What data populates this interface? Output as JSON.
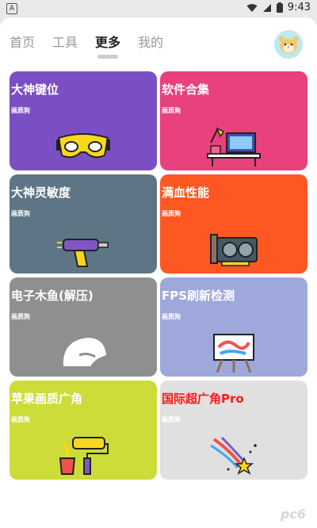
{
  "status_bar": {
    "app_badge": "A",
    "time": "9:43"
  },
  "tabs": [
    {
      "label": "首页",
      "active": false
    },
    {
      "label": "工具",
      "active": false
    },
    {
      "label": "更多",
      "active": true
    },
    {
      "label": "我的",
      "active": false
    }
  ],
  "cards": [
    {
      "title": "大神键位",
      "subtitle": "画质狗",
      "bg": "#7b4fc4",
      "title_color": "#ffffff",
      "icon": "vr-goggles-icon"
    },
    {
      "title": "软件合集",
      "subtitle": "画质狗",
      "bg": "#e8417d",
      "title_color": "#ffffff",
      "icon": "desk-computer-icon"
    },
    {
      "title": "大神灵敏度",
      "subtitle": "画质狗",
      "bg": "#5d7585",
      "title_color": "#ffffff",
      "icon": "power-drill-icon"
    },
    {
      "title": "满血性能",
      "subtitle": "画质狗",
      "bg": "#fe5722",
      "title_color": "#ffffff",
      "icon": "graphics-card-icon"
    },
    {
      "title": "电子木鱼(解压)",
      "subtitle": "画质狗",
      "bg": "#8f8f8f",
      "title_color": "#ffffff",
      "icon": "wooden-fish-icon"
    },
    {
      "title": "FPS刷新检测",
      "subtitle": "画质狗",
      "bg": "#9fa8da",
      "title_color": "#ffffff",
      "icon": "easel-painting-icon"
    },
    {
      "title": "苹果画质广角",
      "subtitle": "画质狗",
      "bg": "#cddc39",
      "title_color": "#ffffff",
      "icon": "paint-roller-icon"
    },
    {
      "title": "国际超广角Pro",
      "subtitle": "画质狗",
      "bg": "#e0e0e0",
      "title_color": "#ff1a1a",
      "icon": "shooting-star-icon"
    }
  ],
  "watermark": "pc6"
}
